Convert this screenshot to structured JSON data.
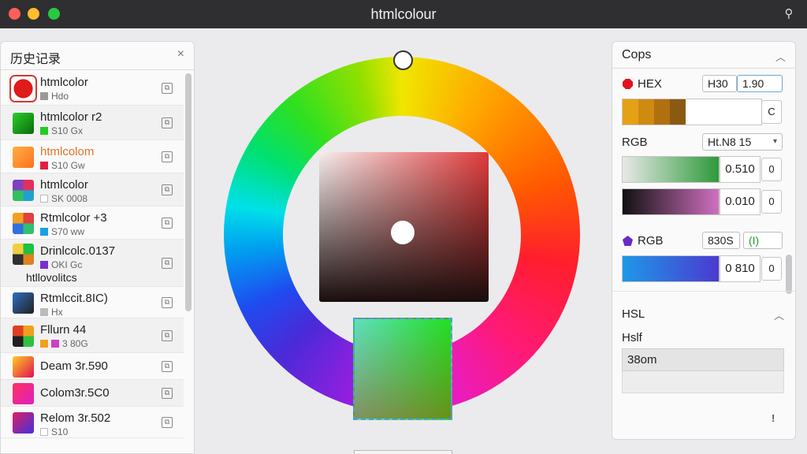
{
  "window": {
    "title": "htmlcolour"
  },
  "icons": {
    "pin": "pin-icon",
    "close": "close-icon",
    "chevron": "chevron-up-icon",
    "copy": "copy-icon"
  },
  "history": {
    "title": "历史记录",
    "close": "×",
    "items": [
      {
        "name": "htmlcolor",
        "sub": "Hdo",
        "chip": "#999999",
        "thumb": "radial-gradient(circle, #e01b1b 60%, #c41010 62%, #fff 64%)",
        "h": 44
      },
      {
        "name": "htmlcolor r2",
        "sub": "S10 Gx",
        "chip": "#22cc22",
        "thumb": "linear-gradient(135deg, #2ad02a, #0a6a0a)",
        "h": 44
      },
      {
        "name": "htmlcolom",
        "sub": "S10 Gw",
        "chip": "#e02040",
        "thumb": "linear-gradient(135deg, #ffb040, #ff7020)",
        "h": 42,
        "accent": "#e0732a"
      },
      {
        "name": "htmlcolor",
        "sub": "SK 0008",
        "chip": "#ffffff",
        "thumb": "conic-gradient(#e03060 0 25%, #20a0d0 0 50%, #30c060 0 75%, #8040c0 0)",
        "h": 42
      },
      {
        "name": "Rtmlcolor +3",
        "sub": "S70 ww",
        "chip": "#1aa0e0",
        "thumb": "conic-gradient(#e04040 0 25%, #30c070 0 50%, #3070e0 0 75%, #f0a020 0)",
        "h": 42
      },
      {
        "name": "Drinlcolc.0137",
        "sub": "OKI Gc",
        "chip": "#7b2fd0",
        "sub2": "htllovolitcs",
        "thumb": "conic-gradient(#20c040 0 25%, #e08020 0 50%, #303030 0 75%, #f0d040 0)",
        "h": 60
      },
      {
        "name": "Rtmlccit.8IC)",
        "sub": "Hx",
        "chip": "#bbbbbb",
        "thumb": "linear-gradient(135deg, #3070c0, #202020)",
        "h": 40
      },
      {
        "name": "Fllurn 44",
        "sub": "3 80G",
        "chip": "#f0a020",
        "chip2": "#d040c0",
        "thumb": "conic-gradient(#f0a020 0 25%, #30c040 0 50%, #202020 0 75%, #e04020 0)",
        "h": 44
      },
      {
        "name": "Deam 3r.590",
        "sub": "",
        "chip": "",
        "thumb": "linear-gradient(135deg, #ffcc20, #e01050)",
        "h": 34
      },
      {
        "name": "Colom3r.5C0",
        "sub": "",
        "chip": "",
        "thumb": "linear-gradient(135deg, #ff3060, #e020c0)",
        "h": 34
      },
      {
        "name": "Relom 3r.502",
        "sub": "S10",
        "chip": "#ffffff",
        "thumb": "linear-gradient(135deg, #e02060, #4030e0)",
        "h": 40
      }
    ]
  },
  "panel": {
    "title": "Cops",
    "hex": {
      "label": "HEX",
      "dot": "#e0141e",
      "field_a": "H30",
      "field_b": "1.90",
      "btn": "C"
    },
    "rgb1": {
      "label": "RGB",
      "select": "Ht.N8 15",
      "val1": "0.510",
      "val2": "0.010",
      "btn": "0"
    },
    "rgb2": {
      "label": "RGB",
      "dot": "#6a28c8",
      "field_a": "830S",
      "field_b": "(I)",
      "val": "0 810",
      "btn": "0"
    },
    "hsl": {
      "label": "HSL",
      "sub": "Hslf",
      "value": "38om"
    },
    "info": "!"
  },
  "colors": {
    "hex_strip": "#e6a015",
    "rgb_strip1": [
      "#e8e8e8",
      "#2e9a3a"
    ],
    "rgb_strip2": [
      "#111111",
      "#d070c0"
    ],
    "rgb_strip3": [
      "#1e98e8",
      "#4a3ad0"
    ]
  }
}
